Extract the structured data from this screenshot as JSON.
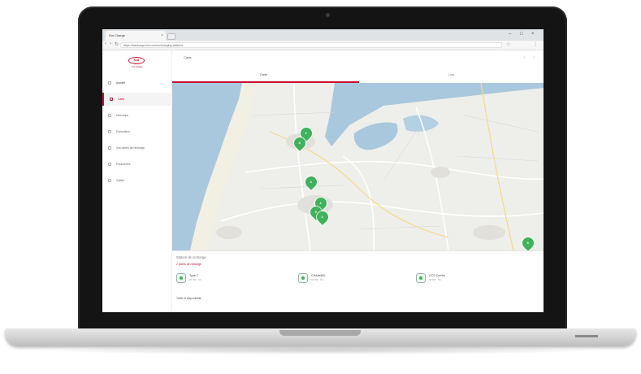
{
  "browser": {
    "tab_title": "Kia Charge",
    "tab_close": "×",
    "new_tab": "",
    "url": "https://kiacharge.kia.com/en/charging-stations",
    "back_icon": "arrow-left-icon",
    "forward_icon": "arrow-right-icon",
    "reload_icon": "reload-icon",
    "bookmark_icon": "star-icon",
    "menu_icon": "more-vert-icon",
    "window_controls": [
      "–",
      "□",
      "×"
    ]
  },
  "sidebar": {
    "logo_text": "KIA",
    "logo_subtitle": "Kia Charge",
    "items": [
      {
        "label": "Accueil"
      },
      {
        "label": "Carte"
      },
      {
        "label": "Historique"
      },
      {
        "label": "Facturation"
      },
      {
        "label": "Vos cartes de recharge"
      },
      {
        "label": "Paramètres"
      },
      {
        "label": "Quitter"
      }
    ],
    "active_index": 1
  },
  "header": {
    "title": "Carte",
    "icons": [
      "search-icon",
      "user-icon"
    ]
  },
  "tabs": [
    {
      "label": "Carte"
    },
    {
      "label": "Liste"
    }
  ],
  "map": {
    "markers": [
      {
        "count": "2"
      },
      {
        "count": "4"
      },
      {
        "count": "3"
      },
      {
        "count": "2"
      },
      {
        "count": "3"
      },
      {
        "count": "2"
      },
      {
        "count": "5"
      }
    ]
  },
  "panel": {
    "title": "Station de recharge",
    "subtitle": "2 points de recharge",
    "connectors": [
      {
        "name": "Type 2",
        "detail": "22 kW · AC"
      },
      {
        "name": "CHAdeMO",
        "detail": "50 kW · DC"
      },
      {
        "name": "CCS Combo",
        "detail": "50 kW · DC"
      }
    ],
    "footer": "Tarifs et disponibilité"
  },
  "colors": {
    "brand": "#c8102e",
    "marker": "#3fb25b",
    "water": "#a9c8de",
    "land": "#eeeeea"
  }
}
